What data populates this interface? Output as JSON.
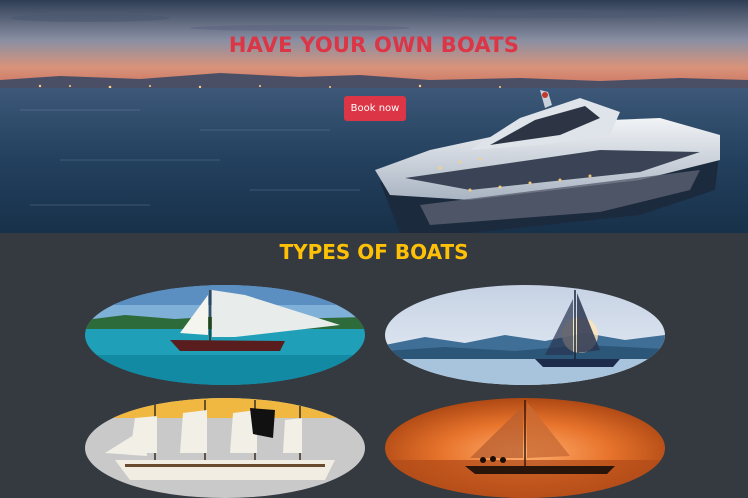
{
  "hero": {
    "title": "HAVE YOUR OWN BOATS",
    "book_button": "Book now"
  },
  "types": {
    "title": "TYPES OF BOATS",
    "boats": [
      {
        "icon": "sailboat-tropical-image"
      },
      {
        "icon": "sailboat-sunset-mountains-image"
      },
      {
        "icon": "tall-ship-image"
      },
      {
        "icon": "sailboat-orange-sunset-image"
      }
    ]
  },
  "colors": {
    "page_bg": "#343a40",
    "accent_red": "#dc3545",
    "accent_yellow": "#ffc107"
  }
}
